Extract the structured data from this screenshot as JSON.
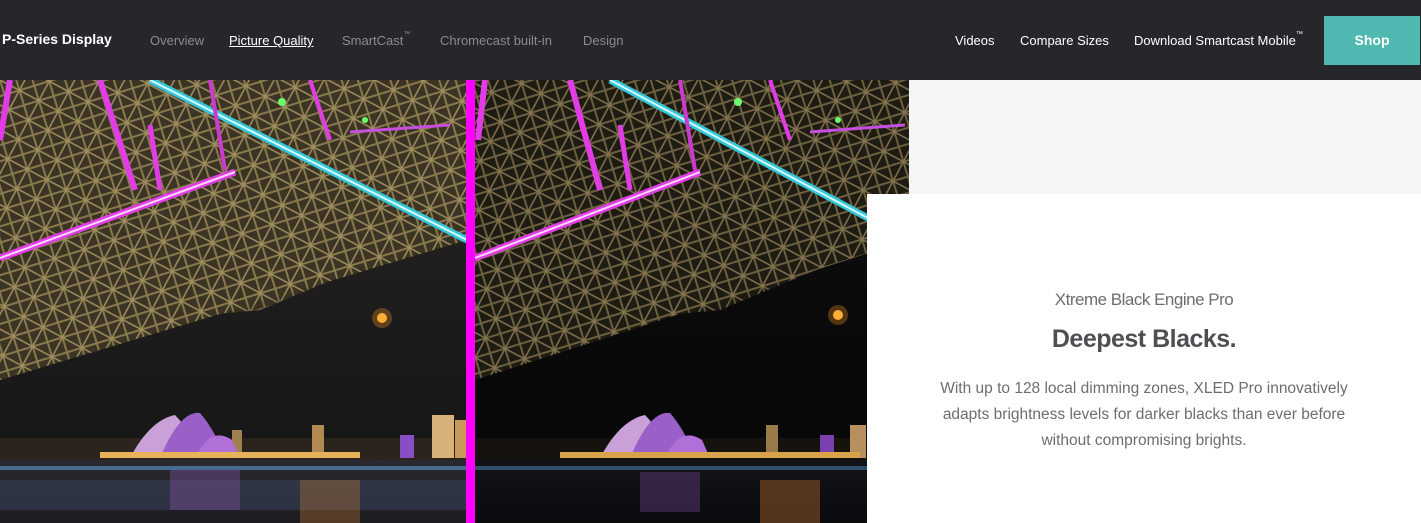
{
  "nav": {
    "brand": "P-Series Display",
    "links": [
      "Overview",
      "Picture Quality",
      "SmartCast",
      "Chromecast built-in",
      "Design"
    ],
    "active_link": "Picture Quality",
    "right_links": [
      "Videos",
      "Compare Sizes",
      "Download Smartcast Mobile"
    ],
    "trademark": "™",
    "shop_label": "Shop"
  },
  "feature": {
    "eyebrow": "Xtreme Black Engine Pro",
    "headline": "Deepest Blacks.",
    "description": "With up to 128 local dimming zones, XLED Pro innovatively adapts brightness levels for darker blacks than ever before without compromising brights."
  },
  "colors": {
    "nav_bg": "#26272a",
    "accent": "#4fb8b0",
    "divider": "#ff00ff",
    "text_dark": "#4d4f52",
    "text_muted": "#6b6d70"
  },
  "icons": {
    "comparison_divider": "vertical-bar"
  }
}
